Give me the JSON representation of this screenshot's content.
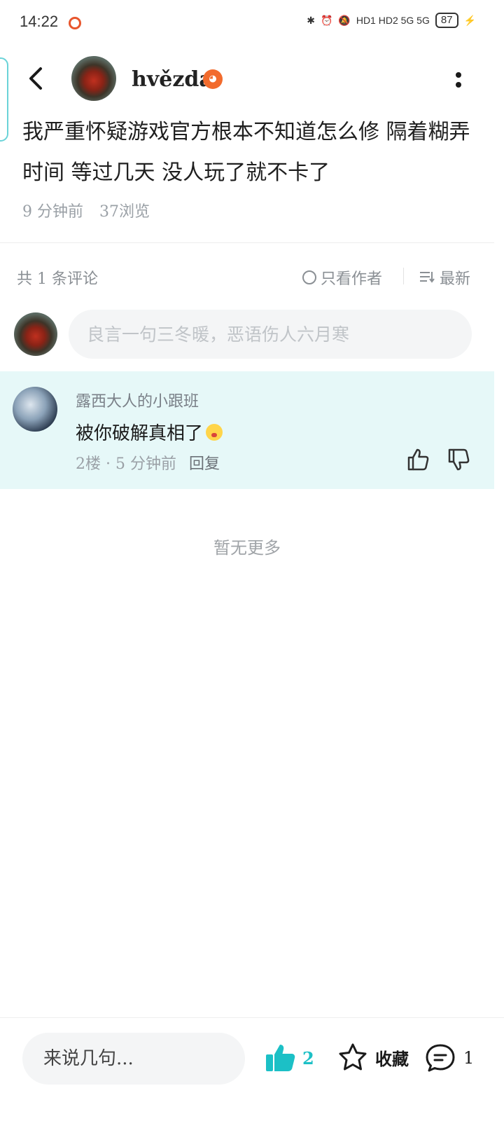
{
  "status_bar": {
    "time": "14:22",
    "network": "HD1 HD2 5G 5G",
    "battery": "87"
  },
  "post": {
    "author": "hvězda",
    "content": "我严重怀疑游戏官方根本不知道怎么修 隔着糊弄时间 等过几天 没人玩了就不卡了",
    "time_ago": "9 分钟前",
    "views": "37浏览"
  },
  "comments_header": {
    "count_text": "共 1 条评论",
    "only_author_label": "只看作者",
    "sort_label": "最新"
  },
  "comment_box": {
    "placeholder": "良言一句三冬暖，恶语伤人六月寒"
  },
  "comments": [
    {
      "user": "露西大人的小跟班",
      "text": "被你破解真相了",
      "meta": "2楼 · 5 分钟前",
      "reply_label": "回复"
    }
  ],
  "no_more_text": "暂无更多",
  "bottom_bar": {
    "input_placeholder": "来说几句...",
    "like_count": "2",
    "favorite_label": "收藏",
    "comment_count": "1"
  },
  "colors": {
    "accent": "#1cc0c6",
    "comment_highlight": "#e6f8f8",
    "badge": "#f26b2d"
  },
  "icons": [
    "back-arrow-icon",
    "more-vertical-icon",
    "circle-icon",
    "sort-icon",
    "thumb-up-icon",
    "thumb-down-icon",
    "star-icon",
    "comment-icon"
  ]
}
